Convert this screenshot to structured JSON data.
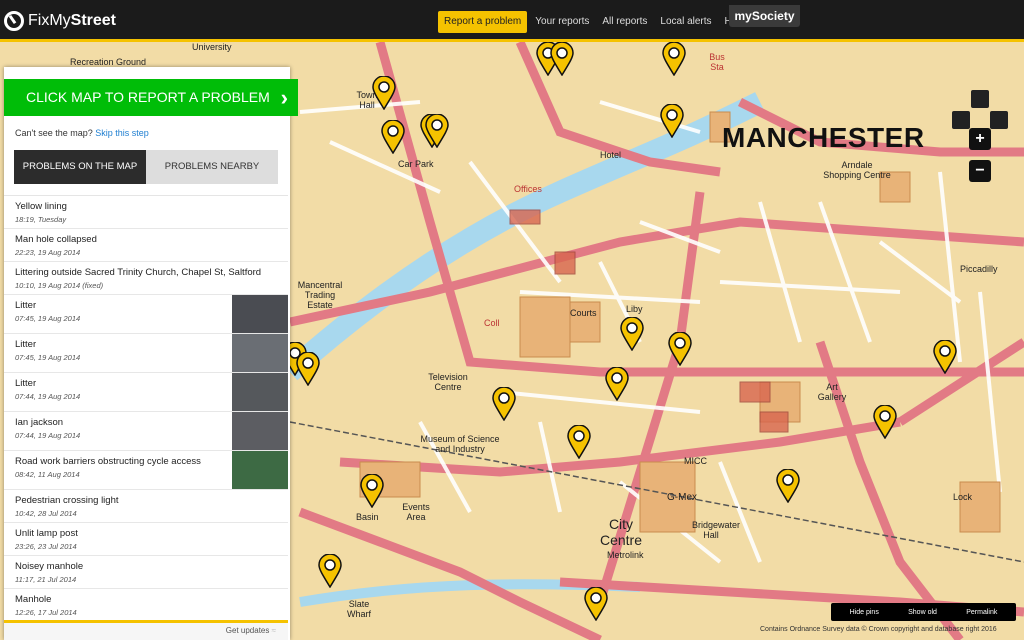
{
  "header": {
    "logo_fix": "FixMy",
    "logo_street": "Street",
    "nav": [
      "Report a problem",
      "Your reports",
      "All reports",
      "Local alerts",
      "Help"
    ],
    "mysociety": "mySociety"
  },
  "sidebar": {
    "report_button": "CLICK MAP TO REPORT A PROBLEM",
    "cant_see_text": "Can't see the map?",
    "skip_link": "Skip this step",
    "tab_on_map": "PROBLEMS ON THE MAP",
    "tab_nearby": "PROBLEMS NEARBY",
    "problems": [
      {
        "title": "Yellow lining",
        "meta": "18:19, Tuesday",
        "thumb": false
      },
      {
        "title": "Man hole collapsed",
        "meta": "22:23, 19 Aug 2014",
        "thumb": false
      },
      {
        "title": "Littering outside Sacred Trinity Church, Chapel St, Saltford",
        "meta": "10:10, 19 Aug 2014 (fixed)",
        "thumb": false
      },
      {
        "title": "Litter",
        "meta": "07:45, 19 Aug 2014",
        "thumb": true
      },
      {
        "title": "Litter",
        "meta": "07:45, 19 Aug 2014",
        "thumb": true
      },
      {
        "title": "Litter",
        "meta": "07:44, 19 Aug 2014",
        "thumb": true
      },
      {
        "title": "Ian jackson",
        "meta": "07:44, 19 Aug 2014",
        "thumb": true
      },
      {
        "title": "Road work barriers obstructing cycle access",
        "meta": "08:42, 11 Aug 2014",
        "thumb": true
      },
      {
        "title": "Pedestrian crossing light",
        "meta": "10:42, 28 Jul 2014",
        "thumb": false
      },
      {
        "title": "Unlit lamp post",
        "meta": "23:26, 23 Jul 2014",
        "thumb": false
      },
      {
        "title": "Noisey manhole",
        "meta": "11:17, 21 Jul 2014",
        "thumb": false
      },
      {
        "title": "Manhole",
        "meta": "12:26, 17 Jul 2014",
        "thumb": false
      }
    ],
    "get_updates": "Get updates"
  },
  "map": {
    "city": "MANCHESTER",
    "labels": {
      "recreation": "Recreation Ground",
      "university": "University",
      "town_hall": "Town Hall",
      "mancental": "Mancentral Trading Estate",
      "television": "Television Centre",
      "museum": "Museum of Science and Industry",
      "city_centre": "City Centre",
      "metrolink": "Metrolink",
      "gmex": "G-Mex",
      "micc": "MICC",
      "arndale": "Arndale Shopping Centre",
      "piccadilly": "Piccadilly",
      "art_gallery": "Art Gallery",
      "slate_wharf": "Slate Wharf",
      "basin": "Basin",
      "events_area": "Events Area",
      "courts": "Courts",
      "coll": "Coll",
      "liby": "Liby",
      "hotel": "Hotel",
      "bridgewater": "Bridgewater Hall",
      "lock": "Lock",
      "car_park": "Car Park",
      "offices": "Offices",
      "bus_sta": "Bus Sta"
    },
    "controls": {
      "zoom_in": "+",
      "zoom_out": "−"
    },
    "bottom_bar": [
      "Hide pins",
      "Show old",
      "Permalink"
    ],
    "attribution": "Contains Ordnance Survey data © Crown copyright and database right 2016"
  },
  "colors": {
    "accent": "#f5c200",
    "report_green": "#00bd08",
    "link_blue": "#1f7fd1"
  }
}
